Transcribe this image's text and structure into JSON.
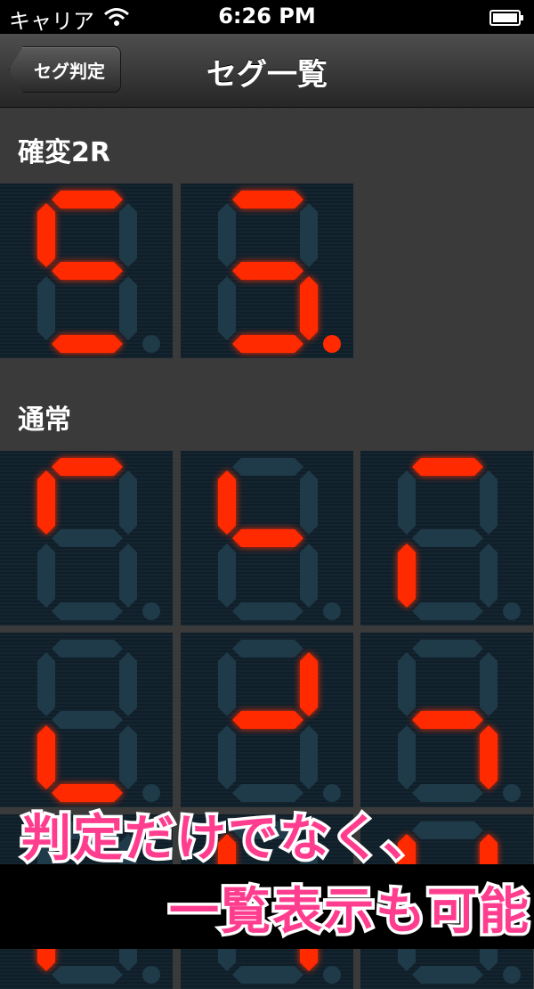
{
  "status_bar": {
    "carrier": "キャリア",
    "time": "6:26 PM"
  },
  "nav": {
    "back_label": "セグ判定",
    "title": "セグ一覧"
  },
  "sections": [
    {
      "label": "確変2R",
      "tiles": [
        {
          "segments": [
            "a",
            "f",
            "g",
            "d"
          ],
          "dot": false
        },
        {
          "segments": [
            "a",
            "g",
            "c",
            "d"
          ],
          "dot": true
        }
      ]
    },
    {
      "label": "通常",
      "tiles": [
        {
          "segments": [
            "a",
            "f"
          ],
          "dot": false
        },
        {
          "segments": [
            "f",
            "g"
          ],
          "dot": false
        },
        {
          "segments": [
            "a",
            "e"
          ],
          "dot": false
        },
        {
          "segments": [
            "e",
            "d"
          ],
          "dot": false
        },
        {
          "segments": [
            "b",
            "g"
          ],
          "dot": false
        },
        {
          "segments": [
            "g",
            "c"
          ],
          "dot": false
        },
        {
          "segments": [
            "e"
          ],
          "dot": false
        },
        {
          "segments": [
            "f",
            "c"
          ],
          "dot": false
        },
        {
          "segments": [
            "f",
            "b"
          ],
          "dot": false
        }
      ]
    }
  ],
  "overlay": {
    "line1": "判定だけでなく、",
    "line2": "一覧表示も可能"
  },
  "colors": {
    "segment_on": "#ff2a00",
    "segment_off": "#1f3a48",
    "caption": "#ff3d8f"
  }
}
